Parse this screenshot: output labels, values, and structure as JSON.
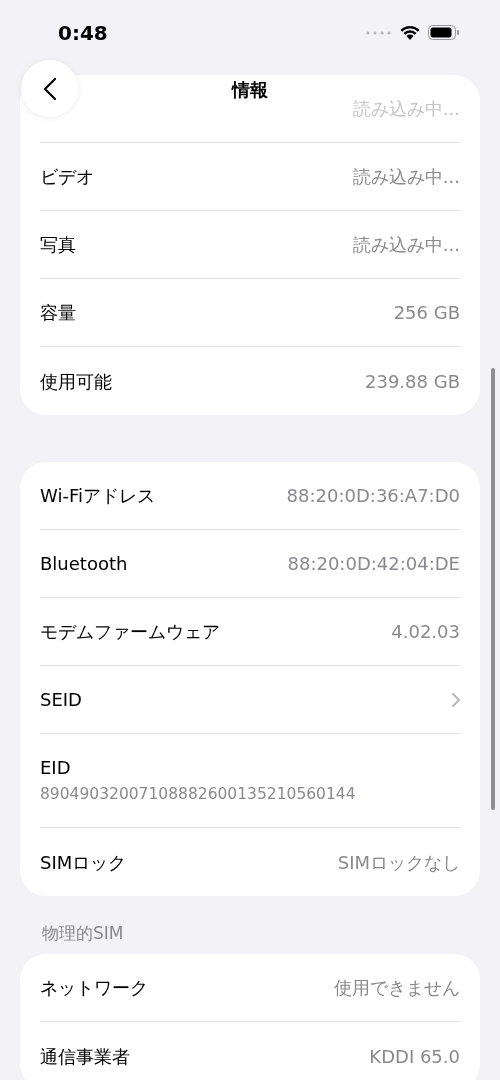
{
  "status_bar": {
    "time": "0:48"
  },
  "nav": {
    "title": "情報"
  },
  "groups": [
    {
      "rows": [
        {
          "kind": "value",
          "value": "読み込み中..."
        },
        {
          "kind": "value",
          "label": "ビデオ",
          "value": "読み込み中..."
        },
        {
          "kind": "value",
          "label": "写真",
          "value": "読み込み中..."
        },
        {
          "kind": "value",
          "label": "容量",
          "value": "256 GB"
        },
        {
          "kind": "value",
          "label": "使用可能",
          "value": "239.88 GB"
        }
      ]
    },
    {
      "rows": [
        {
          "kind": "value",
          "label": "Wi-Fiアドレス",
          "value": "88:20:0D:36:A7:D0"
        },
        {
          "kind": "value",
          "label": "Bluetooth",
          "value": "88:20:0D:42:04:DE"
        },
        {
          "kind": "value",
          "label": "モデムファームウェア",
          "value": "4.02.03"
        },
        {
          "kind": "link",
          "label": "SEID"
        },
        {
          "kind": "stacked",
          "label": "EID",
          "value": "89049032007108882600135210560144"
        },
        {
          "kind": "value",
          "label": "SIMロック",
          "value": "SIMロックなし"
        }
      ]
    },
    {
      "header": "物理的SIM",
      "rows": [
        {
          "kind": "value",
          "label": "ネットワーク",
          "value": "使用できません"
        },
        {
          "kind": "value",
          "label": "通信事業者",
          "value": "KDDI 65.0"
        }
      ]
    }
  ]
}
